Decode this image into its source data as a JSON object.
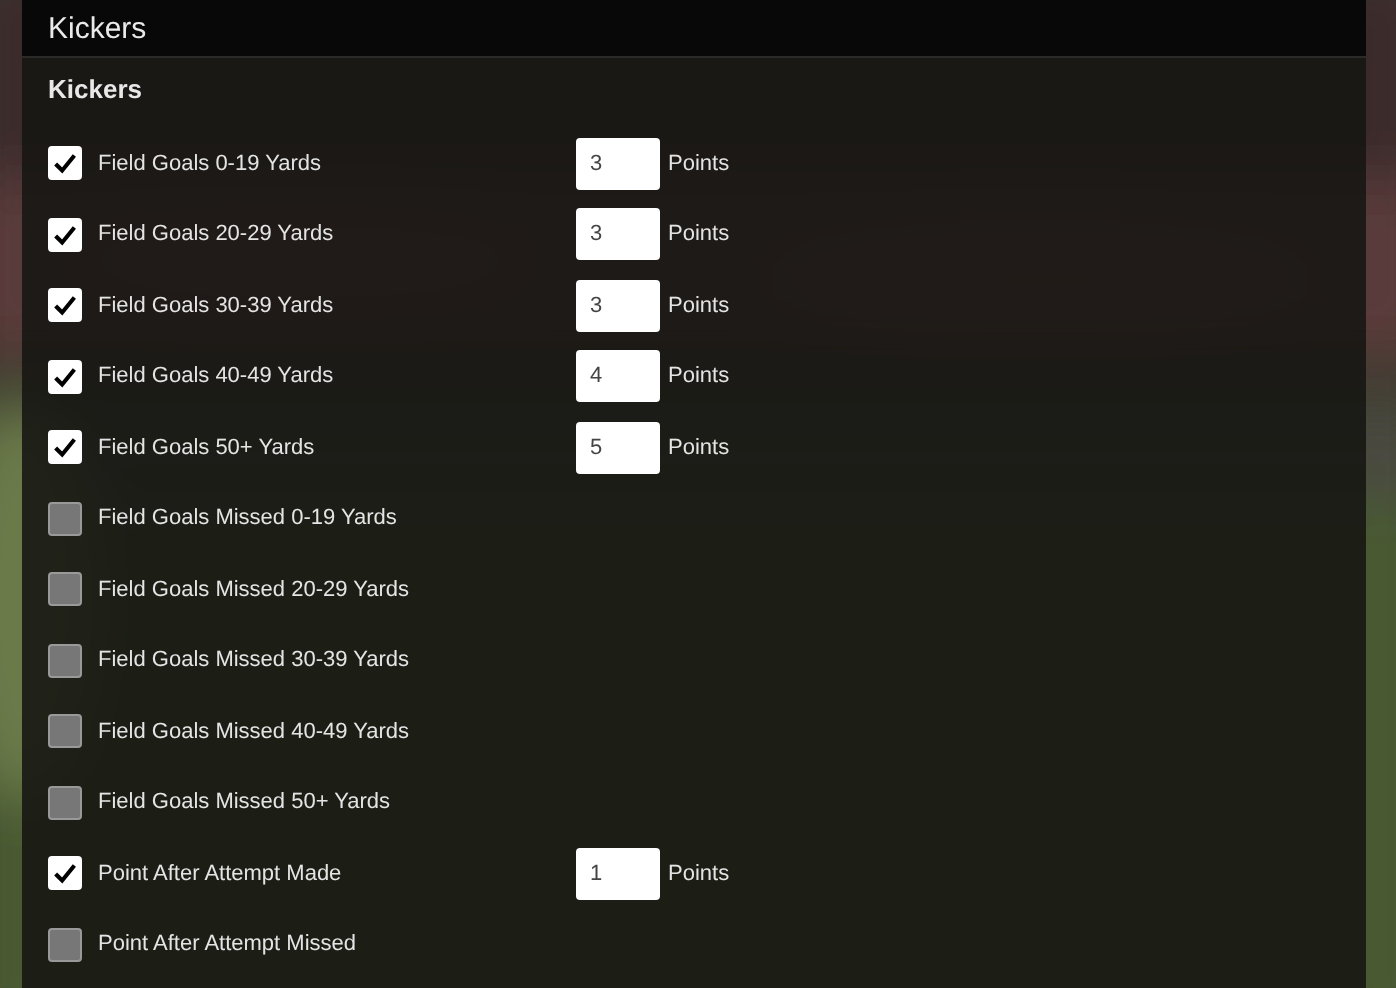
{
  "header": {
    "title": "Kickers"
  },
  "section": {
    "title": "Kickers"
  },
  "rules": [
    {
      "label": "Field Goals 0-19 Yards",
      "checked": true,
      "points": "3",
      "unit": "Points"
    },
    {
      "label": "Field Goals 20-29 Yards",
      "checked": true,
      "points": "3",
      "unit": "Points"
    },
    {
      "label": "Field Goals 30-39 Yards",
      "checked": true,
      "points": "3",
      "unit": "Points"
    },
    {
      "label": "Field Goals 40-49 Yards",
      "checked": true,
      "points": "4",
      "unit": "Points"
    },
    {
      "label": "Field Goals 50+ Yards",
      "checked": true,
      "points": "5",
      "unit": "Points"
    },
    {
      "label": "Field Goals Missed 0-19 Yards",
      "checked": false
    },
    {
      "label": "Field Goals Missed 20-29 Yards",
      "checked": false
    },
    {
      "label": "Field Goals Missed 30-39 Yards",
      "checked": false
    },
    {
      "label": "Field Goals Missed 40-49 Yards",
      "checked": false
    },
    {
      "label": "Field Goals Missed 50+ Yards",
      "checked": false
    },
    {
      "label": "Point After Attempt Made",
      "checked": true,
      "points": "1",
      "unit": "Points"
    },
    {
      "label": "Point After Attempt Missed",
      "checked": false
    }
  ]
}
